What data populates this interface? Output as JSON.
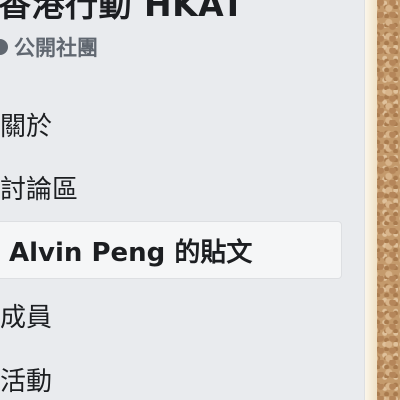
{
  "group": {
    "title": "香港行動 HKAT",
    "privacy_label": "公開社團"
  },
  "nav": {
    "items": [
      {
        "label": "關於"
      },
      {
        "label": "討論區"
      },
      {
        "label": "Alvin Peng 的貼文",
        "active": true
      },
      {
        "label": "成員"
      },
      {
        "label": "活動"
      }
    ]
  },
  "colors": {
    "sidebar_bg": "#e9ebee",
    "active_item_bg": "#f5f6f7",
    "text_primary": "#1c1e21",
    "text_secondary": "#606770"
  },
  "icons": {
    "privacy": "globe-icon"
  }
}
